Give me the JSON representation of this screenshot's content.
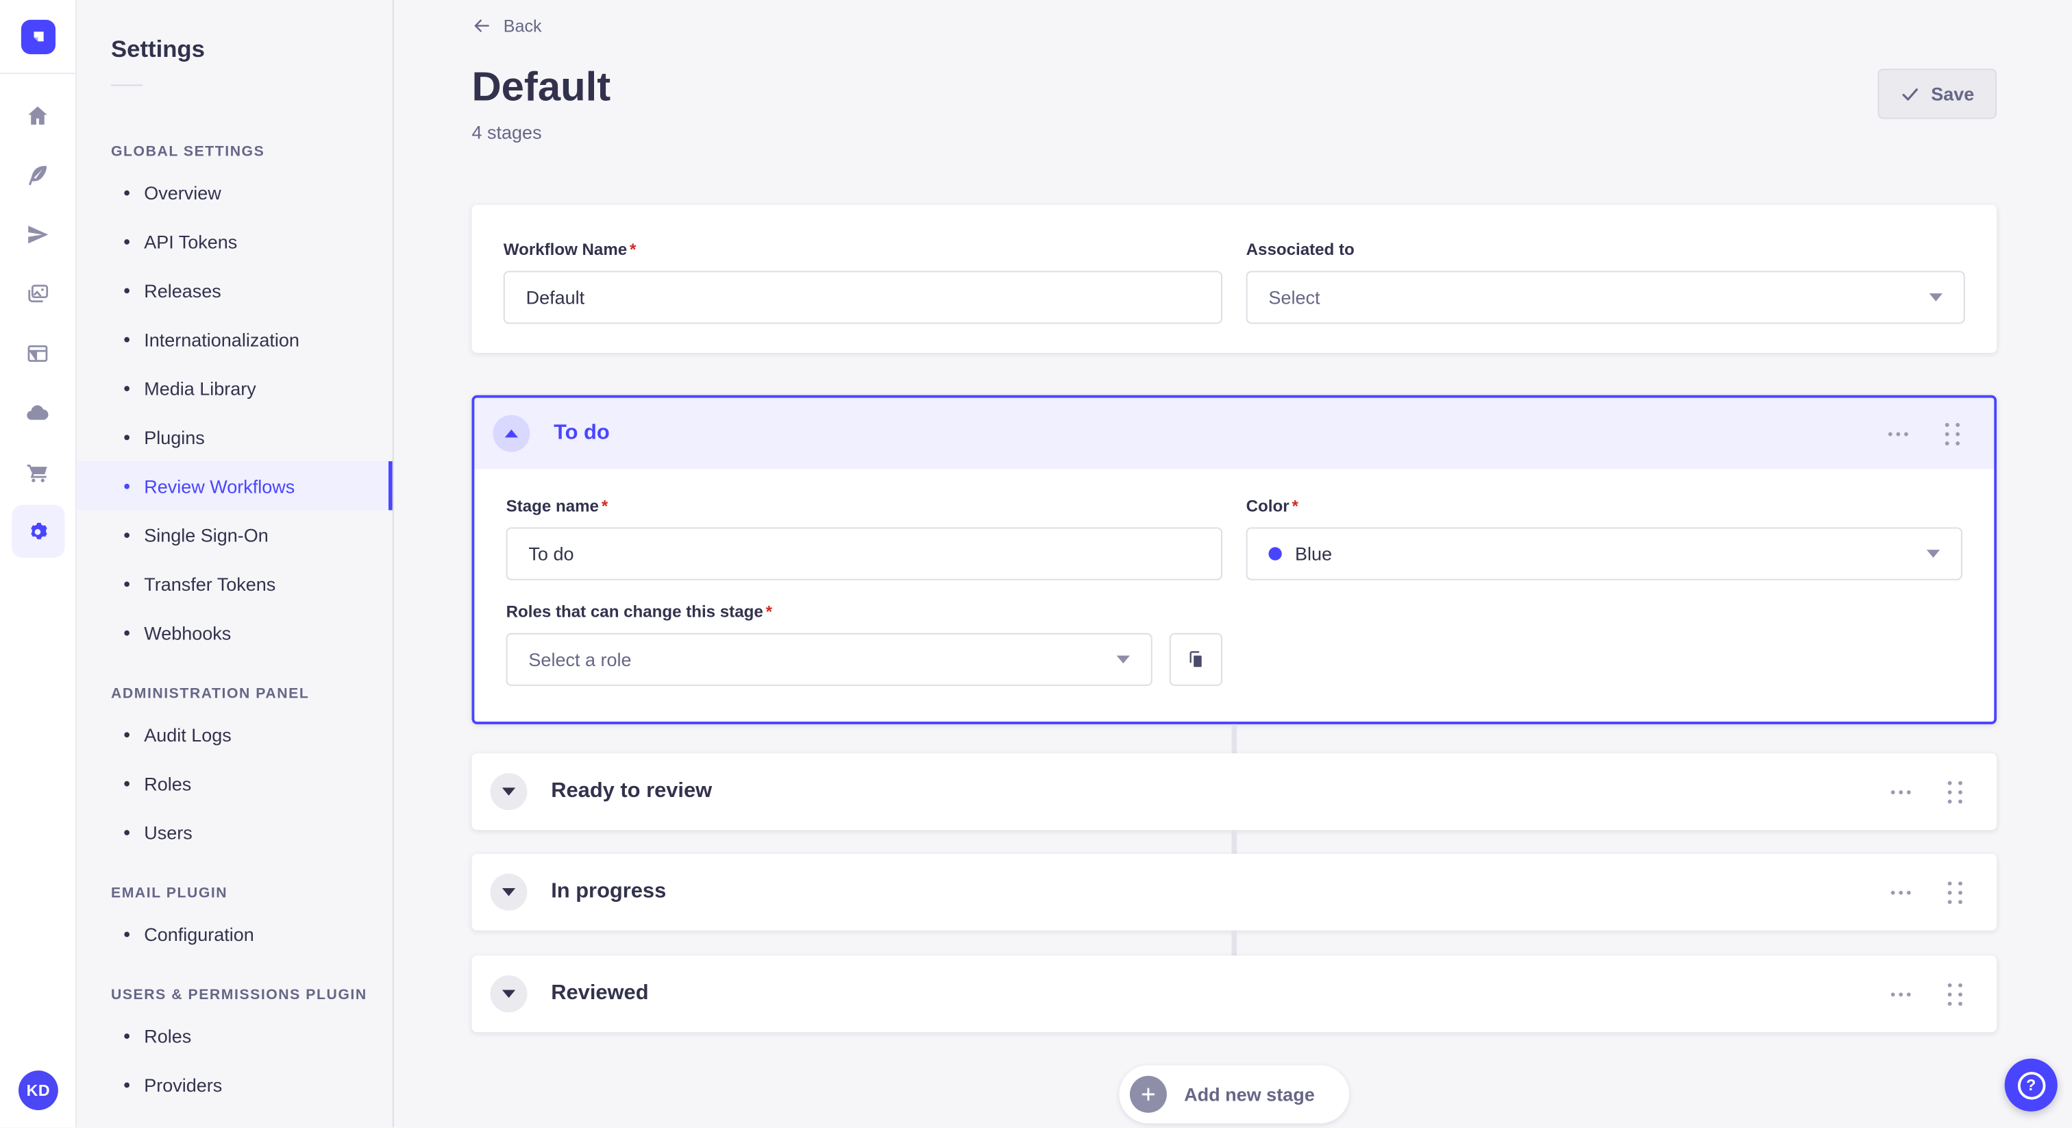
{
  "sidebar_rail": {
    "logo_icon": "strapi-logo",
    "icons": [
      "home-icon",
      "feather-icon",
      "paper-plane-icon",
      "media-library-icon",
      "layout-icon",
      "cloud-icon",
      "marketplace-cart-icon",
      "settings-gear-icon"
    ],
    "active_icon": "settings-gear-icon",
    "avatar_initials": "KD"
  },
  "settings_nav": {
    "title": "Settings",
    "sections": [
      {
        "label": "GLOBAL SETTINGS",
        "items": [
          {
            "label": "Overview"
          },
          {
            "label": "API Tokens"
          },
          {
            "label": "Releases"
          },
          {
            "label": "Internationalization"
          },
          {
            "label": "Media Library"
          },
          {
            "label": "Plugins"
          },
          {
            "label": "Review Workflows",
            "active": true
          },
          {
            "label": "Single Sign-On"
          },
          {
            "label": "Transfer Tokens"
          },
          {
            "label": "Webhooks"
          }
        ]
      },
      {
        "label": "ADMINISTRATION PANEL",
        "items": [
          {
            "label": "Audit Logs"
          },
          {
            "label": "Roles"
          },
          {
            "label": "Users"
          }
        ]
      },
      {
        "label": "EMAIL PLUGIN",
        "items": [
          {
            "label": "Configuration"
          }
        ]
      },
      {
        "label": "USERS & PERMISSIONS PLUGIN",
        "items": [
          {
            "label": "Roles"
          },
          {
            "label": "Providers"
          }
        ]
      }
    ]
  },
  "header": {
    "back_label": "Back",
    "title": "Default",
    "subtitle": "4 stages",
    "save_label": "Save"
  },
  "workflow_form": {
    "name_label": "Workflow Name",
    "name_value": "Default",
    "associated_label": "Associated to",
    "associated_placeholder": "Select"
  },
  "stage_editor": {
    "expanded_stage": {
      "title": "To do",
      "stage_name_label": "Stage name",
      "stage_name_value": "To do",
      "color_label": "Color",
      "color_value": "Blue",
      "color_hex": "#4945ff",
      "roles_label": "Roles that can change this stage",
      "roles_placeholder": "Select a role"
    },
    "collapsed_stages": [
      {
        "title": "Ready to review"
      },
      {
        "title": "In progress"
      },
      {
        "title": "Reviewed"
      }
    ],
    "add_stage_label": "Add new stage"
  },
  "ui": {
    "required_marker": "*"
  },
  "colors": {
    "primary": "#4945ff",
    "primary_bg": "#f0f0ff",
    "text_dark": "#32324d",
    "text_gray": "#666687",
    "border": "#dcdce4",
    "page_bg": "#f6f6f9",
    "danger": "#d02b20"
  }
}
